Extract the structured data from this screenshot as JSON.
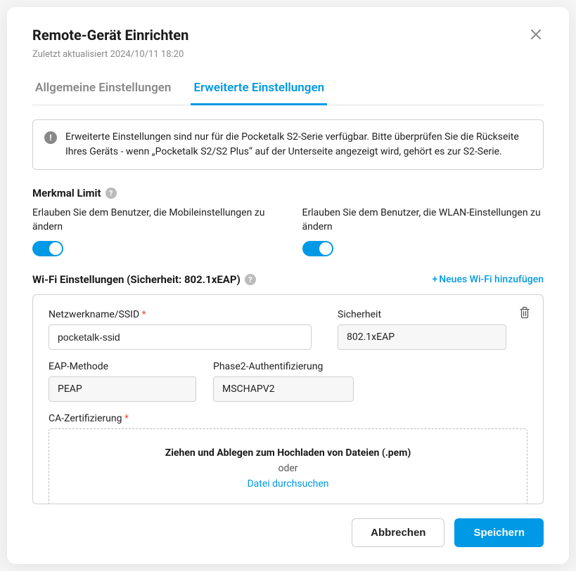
{
  "modal": {
    "title": "Remote-Gerät Einrichten",
    "subtitle": "Zuletzt aktualisiert 2024/10/11 18:20"
  },
  "tabs": {
    "general": "Allgemeine Einstellungen",
    "advanced": "Erweiterte Einstellungen"
  },
  "info": {
    "text": "Erweiterte Einstellungen sind nur für die Pocketalk S2-Serie verfügbar. Bitte überprüfen Sie die Rückseite Ihres Geräts - wenn „Pocketalk S2/S2 Plus“ auf der Unterseite angezeigt wird, gehört es zur S2-Serie."
  },
  "feature_limit": {
    "title": "Merkmal Limit",
    "mobile_label": "Erlauben Sie dem Benutzer, die Mobileinstellungen zu ändern",
    "wlan_label": "Erlauben Sie dem Benutzer, die WLAN-Einstellungen zu ändern"
  },
  "wifi": {
    "title": "Wi-Fi Einstellungen (Sicherheit: 802.1xEAP)",
    "add_label": "Neues Wi-Fi hinzufügen",
    "ssid_label": "Netzwerkname/SSID",
    "ssid_value": "pocketalk-ssid",
    "security_label": "Sicherheit",
    "security_value": "802.1xEAP",
    "eap_label": "EAP-Methode",
    "eap_value": "PEAP",
    "phase2_label": "Phase2-Authentifizierung",
    "phase2_value": "MSCHAPV2",
    "ca_label": "CA-Zertifizierung",
    "dropzone_title": "Ziehen und Ablegen zum Hochladen von Dateien (.pem)",
    "dropzone_or": "oder",
    "dropzone_link": "Datei durchsuchen"
  },
  "footer": {
    "cancel": "Abbrechen",
    "save": "Speichern"
  }
}
